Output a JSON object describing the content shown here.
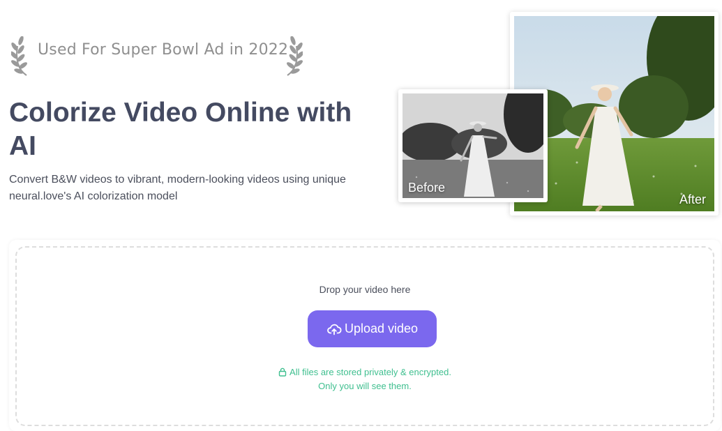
{
  "badge": {
    "text": "Used For Super Bowl Ad in 2022"
  },
  "hero": {
    "title": "Colorize Video Online with AI",
    "description": "Convert B&W videos to vibrant, modern-looking videos using unique neural.love's AI colorization model"
  },
  "comparison": {
    "before_label": "Before",
    "after_label": "After"
  },
  "upload": {
    "drop_text": "Drop your video here",
    "button_label": "Upload video",
    "privacy_line1": "All files are stored privately & encrypted.",
    "privacy_line2": "Only you will see them."
  },
  "colors": {
    "accent": "#7b68ee",
    "title": "#444a61",
    "privacy": "#3fbf8f",
    "badge": "#8f8f8f"
  },
  "icons": {
    "laurel_left": "laurel-left-icon",
    "laurel_right": "laurel-right-icon",
    "upload": "cloud-upload-icon",
    "lock": "lock-icon"
  }
}
